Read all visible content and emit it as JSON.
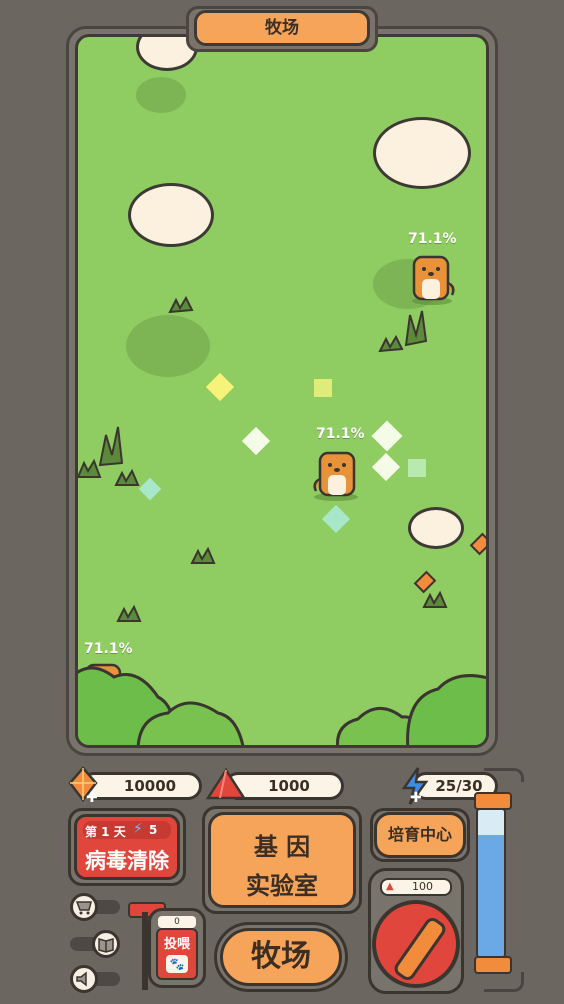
{
  "header": {
    "title": "牧场"
  },
  "pets": [
    {
      "percent": "71.1%"
    },
    {
      "percent": "71.1%"
    },
    {
      "percent": "71.1%"
    }
  ],
  "resources": {
    "crystals": "10000",
    "gems": "1000",
    "energy": "25/30"
  },
  "virus_card": {
    "day_label": "第 1 天",
    "energy_cost": "5",
    "title": "病毒清除"
  },
  "lab_button": {
    "line1": "基  因",
    "line2": "实验室"
  },
  "breed_button": {
    "label": "培育中心"
  },
  "ranch_button": {
    "label": "牧场"
  },
  "feed_box": {
    "count": "0",
    "label": "投喂"
  },
  "machine": {
    "cost": "100"
  },
  "tank": {
    "fill_fraction": 0.83
  },
  "colors": {
    "accent": "#f5a45a",
    "grass": "#8fcc61",
    "red": "#e0463c",
    "frame": "#78736b"
  }
}
